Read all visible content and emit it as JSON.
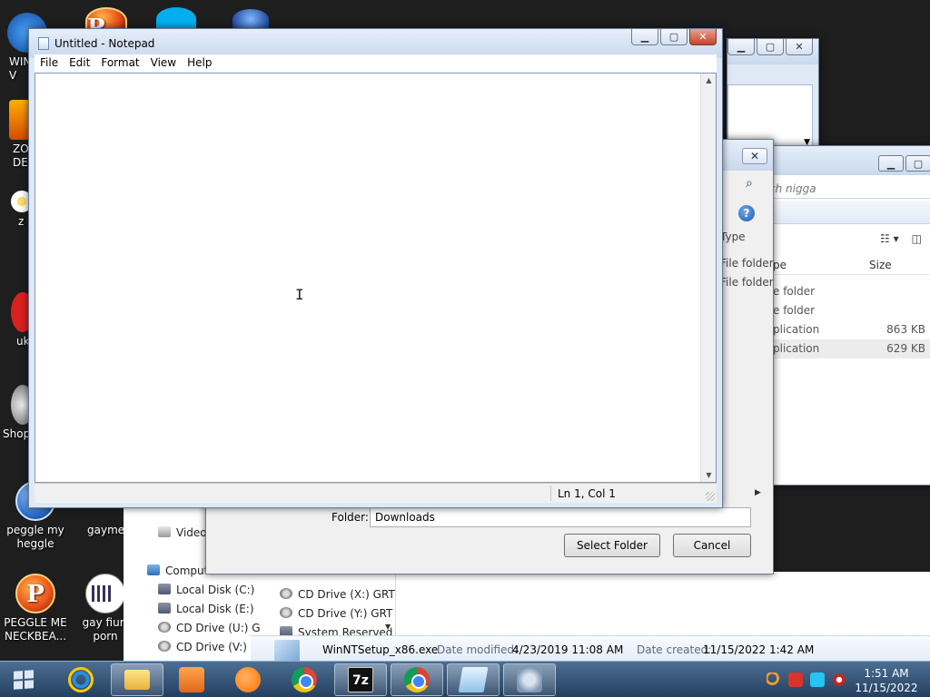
{
  "desktop": {
    "icons": [
      {
        "label": "WIN\nV"
      },
      {
        "label": "ZO\nDE"
      },
      {
        "label": "z"
      },
      {
        "label": "uk"
      },
      {
        "label": "Shop"
      },
      {
        "label": "peggle my heggle"
      },
      {
        "label": "gaymes"
      },
      {
        "label": "PEGGLE ME NECKBEA..."
      },
      {
        "label": "gay fiurr porn"
      }
    ]
  },
  "notepad": {
    "title": "Untitled - Notepad",
    "menus": [
      "File",
      "Edit",
      "Format",
      "View",
      "Help"
    ],
    "status_position": "Ln 1, Col 1"
  },
  "explorer": {
    "search_placeholder": "ch nigga",
    "columns": {
      "type": "pe",
      "size": "Size"
    },
    "rows": [
      {
        "type": "e folder",
        "size": ""
      },
      {
        "type": "e folder",
        "size": ""
      },
      {
        "type": "plication",
        "size": "863 KB"
      },
      {
        "type": "plication",
        "size": "629 KB"
      }
    ],
    "nav": {
      "videos": "Video",
      "computer": "Comput",
      "local_c": "Local Disk (C:)",
      "local_e": "Local Disk (E:)",
      "cd_u": "CD Drive (U:) G",
      "cd_v": "CD Drive (V:) v"
    },
    "list": [
      "CD Drive (X:) GRT",
      "CD Drive (Y:) GRT",
      "System Reserved"
    ],
    "details": {
      "filename": "WinNTSetup_x86.exe",
      "modified_label": "Date modified:",
      "modified_value": "4/23/2019 11:08 AM",
      "created_label": "Date created:",
      "created_value": "11/15/2022 1:42 AM"
    }
  },
  "dialog": {
    "col_type": "Type",
    "items": [
      "File folder",
      "File folder"
    ],
    "folder_label": "Folder:",
    "folder_value": "Downloads",
    "select_button": "Select Folder",
    "cancel_button": "Cancel"
  },
  "taskbar": {
    "time": "1:51 AM",
    "date": "11/15/2022",
    "apps": [
      "internet-explorer",
      "file-explorer",
      "media-player",
      "uc-browser",
      "chrome",
      "7-zip",
      "chrome",
      "notepad",
      "setup"
    ]
  }
}
